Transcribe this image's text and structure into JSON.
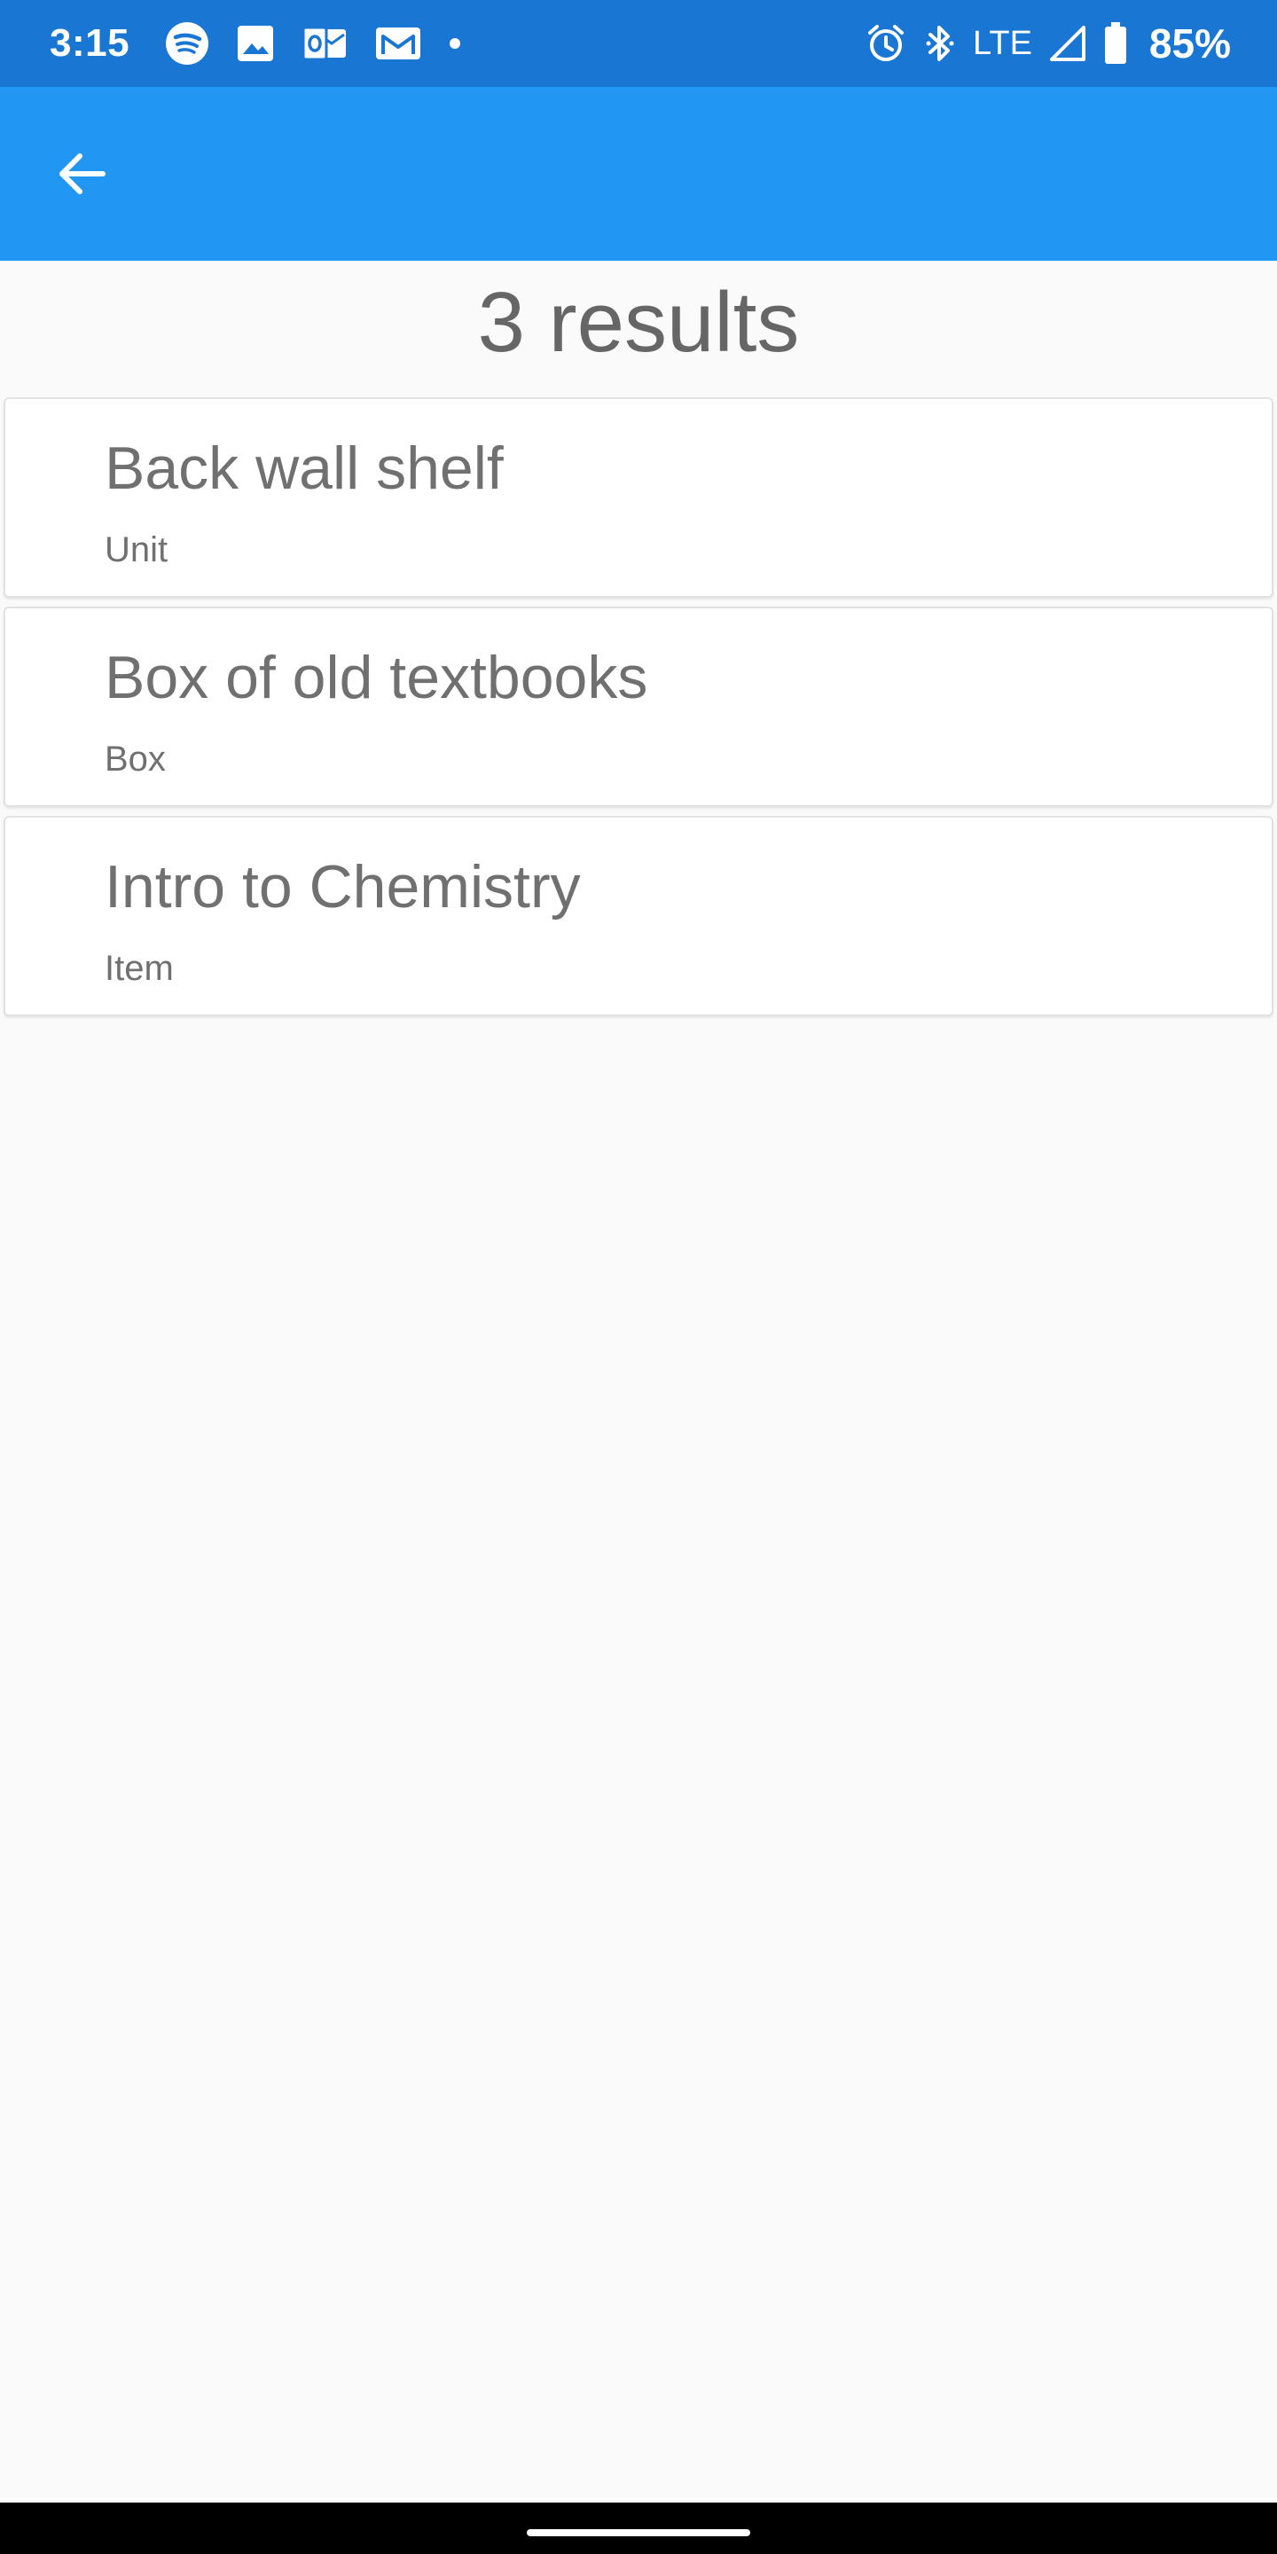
{
  "status_bar": {
    "time": "3:15",
    "network": "LTE",
    "battery": "85%",
    "left_icons": [
      "spotify-icon",
      "photos-icon",
      "outlook-icon",
      "gmail-icon",
      "dot-icon"
    ],
    "right_icons": [
      "alarm-icon",
      "bluetooth-icon",
      "signal-icon",
      "battery-icon"
    ]
  },
  "app_bar": {
    "color": "#2196f3",
    "back_icon": "arrow-left-icon"
  },
  "results": {
    "count_label": "3 results",
    "items": [
      {
        "name": "Back wall shelf",
        "type": "Unit"
      },
      {
        "name": "Box of old textbooks",
        "type": "Box"
      },
      {
        "name": "Intro to Chemistry",
        "type": "Item"
      }
    ]
  },
  "colors": {
    "status_bar": "#1976d2",
    "app_bar": "#2196f3",
    "background": "#fafafa",
    "text": "#707070"
  }
}
